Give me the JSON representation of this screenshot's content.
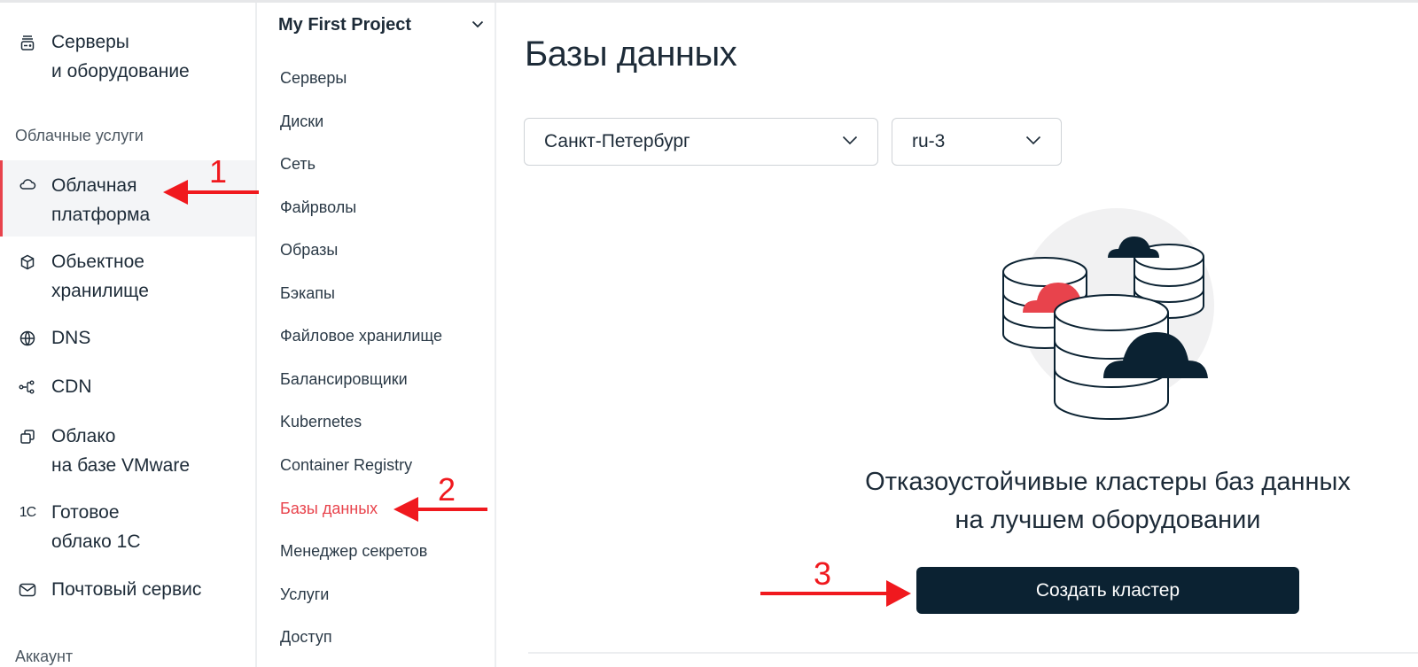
{
  "sidebar": {
    "items": [
      {
        "label": "Серверы\nи оборудование",
        "icon": "server-icon"
      },
      {
        "label": "Облачная\nплатформа",
        "icon": "cloud-icon",
        "active": true
      },
      {
        "label": "Обьектное\nхранилище",
        "icon": "cube-icon"
      },
      {
        "label": "DNS",
        "icon": "globe-icon"
      },
      {
        "label": "CDN",
        "icon": "network-icon"
      },
      {
        "label": "Облако\nна базе VMware",
        "icon": "layers-icon"
      },
      {
        "label": "Готовое\nоблако 1С",
        "icon": "1c-icon",
        "icon_text": "1C"
      },
      {
        "label": "Почтовый сервис",
        "icon": "mail-icon"
      }
    ],
    "section_cloud": "Облачные услуги",
    "section_account": "Аккаунт"
  },
  "project_nav": {
    "project_name": "My First Project",
    "items": [
      {
        "label": "Серверы"
      },
      {
        "label": "Диски"
      },
      {
        "label": "Сеть"
      },
      {
        "label": "Файрволы"
      },
      {
        "label": "Образы"
      },
      {
        "label": "Бэкапы"
      },
      {
        "label": "Файловое хранилище"
      },
      {
        "label": "Балансировщики"
      },
      {
        "label": "Kubernetes"
      },
      {
        "label": "Container Registry"
      },
      {
        "label": "Базы данных",
        "active": true
      },
      {
        "label": "Менеджер секретов"
      },
      {
        "label": "Услуги"
      },
      {
        "label": "Доступ"
      }
    ]
  },
  "main": {
    "title": "Базы данных",
    "region_select": {
      "value": "Санкт-Петербург"
    },
    "zone_select": {
      "value": "ru-3"
    },
    "promo_line1": "Отказоустойчивые кластеры баз данных",
    "promo_line2": "на лучшем оборудовании",
    "create_button": "Создать кластер"
  },
  "annotations": {
    "step1": "1",
    "step2": "2",
    "step3": "3"
  },
  "colors": {
    "accent": "#e8434c",
    "primary_dark": "#0b2232",
    "annotation_red": "#f0191e"
  }
}
